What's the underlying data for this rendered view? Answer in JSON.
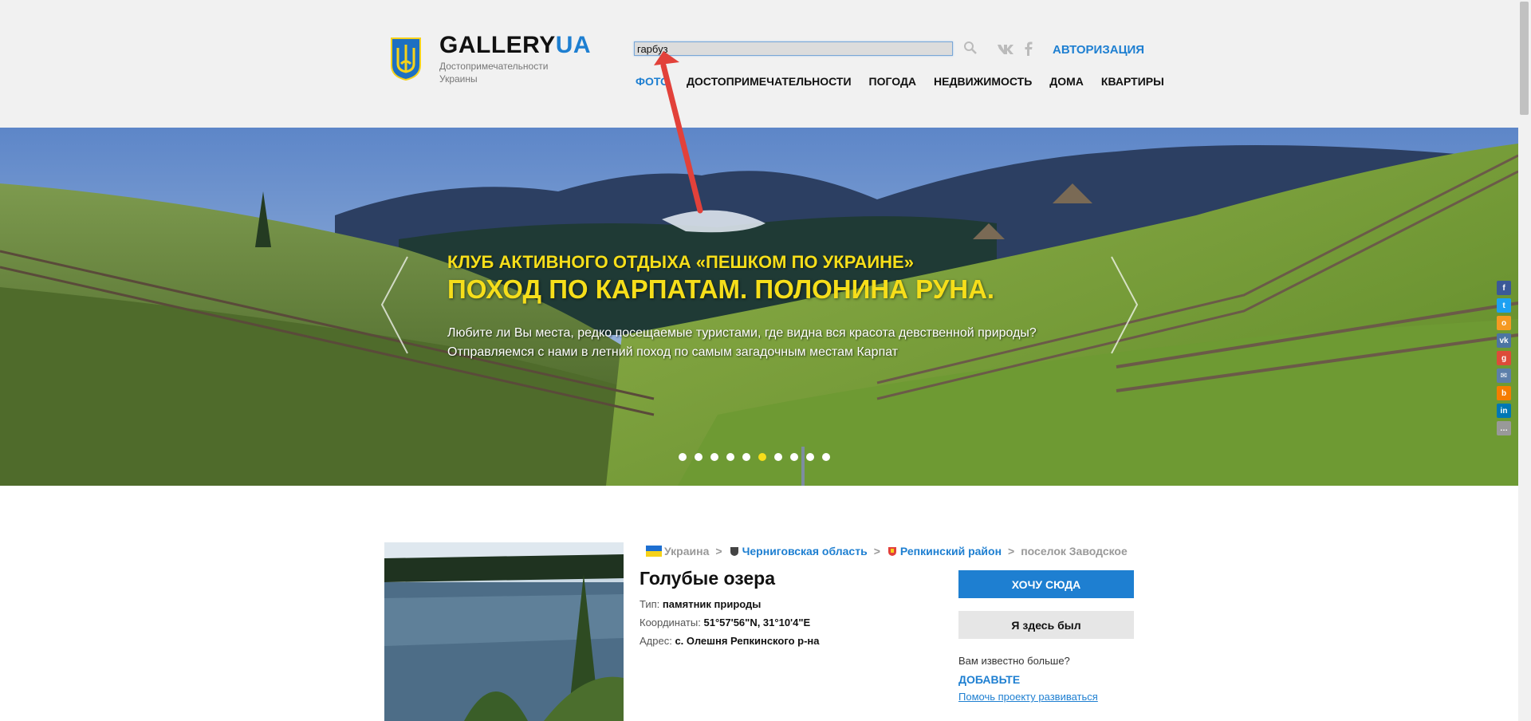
{
  "logo": {
    "title_main": "GALLERY",
    "title_accent": "UA",
    "subtitle_line1": "Достопримечательности",
    "subtitle_line2": "Украины"
  },
  "search": {
    "value": "гарбуз"
  },
  "auth": {
    "label": "АВТОРИЗАЦИЯ"
  },
  "nav": {
    "items": [
      "ФОТО",
      "ДОСТОПРИМЕЧАТЕЛЬНОСТИ",
      "ПОГОДА",
      "НЕДВИЖИМОСТЬ",
      "ДОМА",
      "КВАРТИРЫ"
    ],
    "active_index": 0
  },
  "hero": {
    "kicker": "КЛУБ АКТИВНОГО ОТДЫХА «ПЕШКОМ ПО УКРАИНЕ»",
    "title": "ПОХОД ПО КАРПАТАМ. ПОЛОНИНА РУНА.",
    "text_line1": "Любите ли Вы места, редко посещаемые туристами, где видна вся красота девственной природы?",
    "text_line2": "Отправляемся с нами в летний поход по самым загадочным местам Карпат",
    "slides_count": 10,
    "active_slide": 5
  },
  "share_icons": [
    "facebook-icon",
    "twitter-icon",
    "odnoklassniki-icon",
    "vk-icon",
    "google-plus-icon",
    "email-icon",
    "blogger-icon",
    "linkedin-icon",
    "more-icon"
  ],
  "breadcrumb": {
    "country": "Украина",
    "region": "Черниговская область",
    "district": "Репкинский район",
    "locality": "поселок Заводское",
    "sep": ">"
  },
  "place": {
    "title": "Голубые озера",
    "type_label": "Тип:",
    "type_value": "памятник природы",
    "coords_label": "Координаты:",
    "coords_value": "51°57'56\"N, 31°10'4\"E",
    "address_label": "Адрес:",
    "address_value": "с. Олешня Репкинского р-на"
  },
  "actions": {
    "want": "ХОЧУ СЮДА",
    "been": "Я здесь был",
    "know_more": "Вам известно больше?",
    "add": "ДОБАВЬТЕ",
    "help": "Помочь проекту развиваться"
  },
  "colors": {
    "accent": "#1e7fd1",
    "hero_title": "#f6de1a",
    "header_bg": "#f1f1f1",
    "annotation_arrow": "#e2413a"
  }
}
